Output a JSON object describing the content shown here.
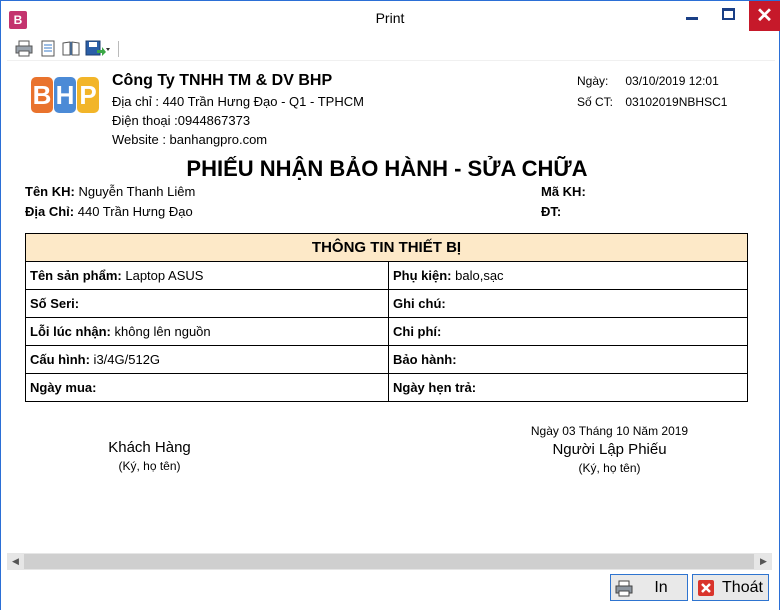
{
  "window": {
    "app_icon_letter": "B",
    "title": "Print",
    "close_glyph": "✕"
  },
  "toolbar": {
    "icons": [
      "printer-icon",
      "page-setup-icon",
      "book-view-icon",
      "export-save-icon"
    ]
  },
  "company": {
    "logo_letters": [
      "B",
      "H",
      "P"
    ],
    "name": "Công Ty TNHH TM & DV BHP",
    "address": "Địa chỉ : 440 Trần Hưng Đạo - Q1 - TPHCM",
    "phone": "Điện thoại :0944867373",
    "website": "Website : banhangpro.com"
  },
  "meta": {
    "date_label": "Ngày:",
    "date_value": "03/10/2019 12:01",
    "doc_no_label": "Số CT:",
    "doc_no_value": "03102019NBHSC1"
  },
  "document": {
    "title": "PHIẾU NHẬN BẢO HÀNH - SỬA CHỮA"
  },
  "customer": {
    "name_label": "Tên KH:",
    "name_value": " Nguyễn Thanh Liêm",
    "address_label": "Địa Chỉ:",
    "address_value": " 440 Trần Hưng Đạo",
    "code_label": "Mã KH:",
    "phone_label": "ĐT:"
  },
  "device": {
    "header": "THÔNG TIN THIẾT BỊ",
    "rows": [
      {
        "left_label": "Tên sản phẩm:",
        "left_value": " Laptop ASUS",
        "right_label": "Phụ kiện:",
        "right_value": " balo,sạc"
      },
      {
        "left_label": "Số Seri:",
        "left_value": "",
        "right_label": "Ghi chú:",
        "right_value": ""
      },
      {
        "left_label": "Lỗi lúc nhận:",
        "left_value": " không lên nguồn",
        "right_label": "Chi phí:",
        "right_value": ""
      },
      {
        "left_label": "Cấu hình:",
        "left_value": " i3/4G/512G",
        "right_label": "Bảo hành:",
        "right_value": ""
      },
      {
        "left_label": "Ngày mua:",
        "left_value": "",
        "right_label": "Ngày hẹn trả:",
        "right_value": ""
      }
    ]
  },
  "signatures": {
    "customer_role": "Khách Hàng",
    "customer_note": "(Ký, họ tên)",
    "date_line": "Ngày 03 Tháng 10 Năm 2019",
    "creator_role": "Người Lập Phiếu",
    "creator_note": "(Ký, họ tên)"
  },
  "footer": {
    "print_label": "In",
    "exit_label": "Thoát"
  },
  "colors": {
    "accent": "#2e74d0",
    "close_red": "#c6192a",
    "table_header": "#fde9c8"
  }
}
